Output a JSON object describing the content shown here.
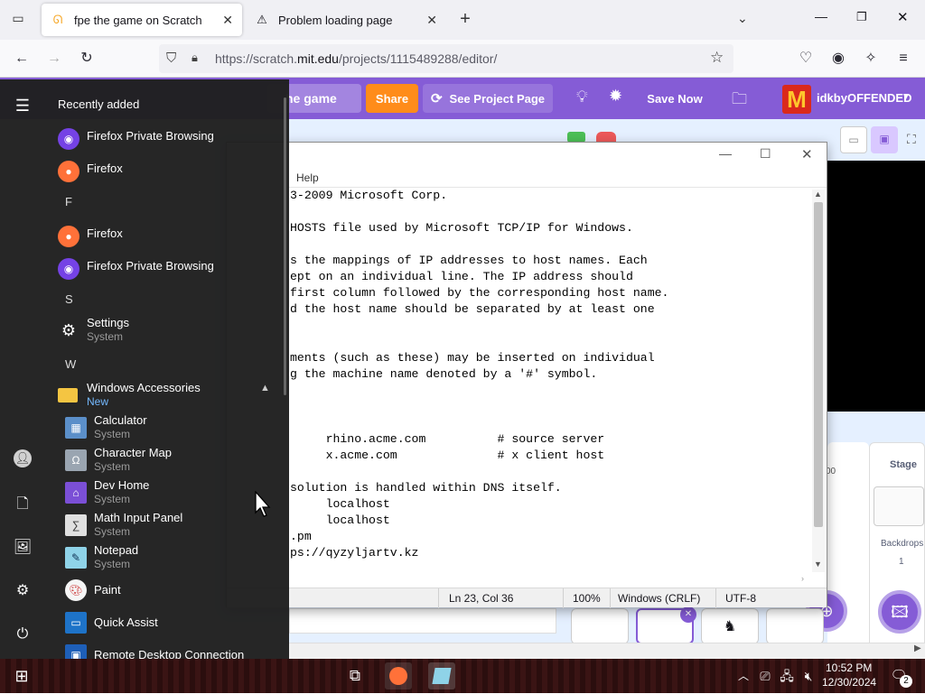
{
  "browser": {
    "tabs": [
      {
        "title": "fpe the game on Scratch",
        "icon": "scratch-cat-icon",
        "active": true
      },
      {
        "title": "Problem loading page",
        "icon": "warning-icon",
        "active": false
      }
    ],
    "url_prefix": "https://scratch.",
    "url_domain": "mit.edu",
    "url_suffix": "/projects/1115489288/editor/"
  },
  "scratch": {
    "title_fragment": "he game",
    "share": "Share",
    "see_project": "See Project Page",
    "save_now": "Save Now",
    "username": "idkbyOFFENDED",
    "stage_label": "Stage",
    "backdrops_label": "Backdrops",
    "backdrops_count": "1",
    "side_num": "00",
    "accent": "#855cd6",
    "share_color": "#ff8c1a"
  },
  "notepad": {
    "menu_help": "Help",
    "lines": [
      "3-2009 Microsoft Corp.",
      "",
      "HOSTS file used by Microsoft TCP/IP for Windows.",
      "",
      "s the mappings of IP addresses to host names. Each",
      "ept on an individual line. The IP address should",
      "first column followed by the corresponding host name.",
      "d the host name should be separated by at least one",
      "",
      "",
      "ments (such as these) may be inserted on individual",
      "g the machine name denoted by a '#' symbol.",
      "",
      "",
      "",
      "     rhino.acme.com          # source server",
      "     x.acme.com              # x client host",
      "",
      "solution is handled within DNS itself.",
      "     localhost",
      "     localhost",
      ".pm",
      "ps://qyzyljartv.kz"
    ],
    "status": {
      "position": "Ln 23, Col 36",
      "zoom": "100%",
      "eol": "Windows (CRLF)",
      "encoding": "UTF-8"
    }
  },
  "start_menu": {
    "section_title": "Recently added",
    "recent": [
      {
        "label": "Firefox Private Browsing",
        "icon": "firefox-private-icon"
      },
      {
        "label": "Firefox",
        "icon": "firefox-icon"
      }
    ],
    "groups": [
      {
        "letter": "F",
        "items": [
          {
            "label": "Firefox",
            "icon": "firefox-icon"
          },
          {
            "label": "Firefox Private Browsing",
            "icon": "firefox-private-icon"
          }
        ]
      },
      {
        "letter": "S",
        "items": [
          {
            "label": "Settings",
            "sub": "System",
            "icon": "gear-icon"
          }
        ]
      },
      {
        "letter": "W",
        "items": [
          {
            "label": "Windows Accessories",
            "sub": "New",
            "icon": "folder-icon"
          }
        ]
      }
    ],
    "accessories": [
      {
        "label": "Calculator",
        "sub": "System"
      },
      {
        "label": "Character Map",
        "sub": "System"
      },
      {
        "label": "Dev Home",
        "sub": "System"
      },
      {
        "label": "Math Input Panel",
        "sub": "System"
      },
      {
        "label": "Notepad",
        "sub": "System"
      },
      {
        "label": "Paint",
        "sub": ""
      },
      {
        "label": "Quick Assist",
        "sub": ""
      },
      {
        "label": "Remote Desktop Connection",
        "sub": ""
      }
    ]
  },
  "taskbar": {
    "time": "10:52 PM",
    "date": "12/30/2024",
    "notifications": "2"
  }
}
